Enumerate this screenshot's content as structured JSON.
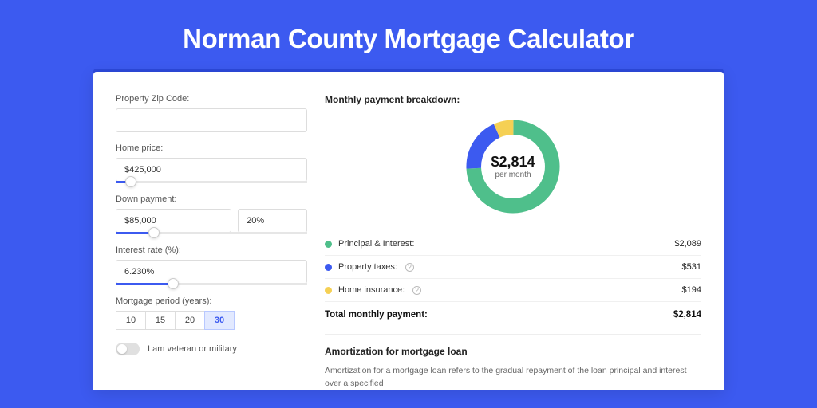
{
  "title": "Norman County Mortgage Calculator",
  "form": {
    "zip_label": "Property Zip Code:",
    "zip_value": "",
    "homeprice_label": "Home price:",
    "homeprice_value": "$425,000",
    "homeprice_slider_pct": 8,
    "downpayment_label": "Down payment:",
    "downpayment_value": "$85,000",
    "downpayment_pct": "20%",
    "downpayment_slider_pct": 20,
    "rate_label": "Interest rate (%):",
    "rate_value": "6.230%",
    "rate_slider_pct": 30,
    "period_label": "Mortgage period (years):",
    "periods": [
      "10",
      "15",
      "20",
      "30"
    ],
    "period_active": "30",
    "veteran_label": "I am veteran or military",
    "veteran_on": false
  },
  "breakdown": {
    "title": "Monthly payment breakdown:",
    "donut": {
      "amount": "$2,814",
      "sub": "per month"
    },
    "items": [
      {
        "label": "Principal & Interest:",
        "value": "$2,089",
        "color": "#4fbf8b",
        "info": false
      },
      {
        "label": "Property taxes:",
        "value": "$531",
        "color": "#3c5af0",
        "info": true
      },
      {
        "label": "Home insurance:",
        "value": "$194",
        "color": "#f5d054",
        "info": true
      }
    ],
    "total_label": "Total monthly payment:",
    "total_value": "$2,814"
  },
  "amort": {
    "title": "Amortization for mortgage loan",
    "text": "Amortization for a mortgage loan refers to the gradual repayment of the loan principal and interest over a specified"
  },
  "chart_data": {
    "type": "pie",
    "title": "Monthly payment breakdown",
    "series": [
      {
        "name": "Principal & Interest",
        "value": 2089,
        "color": "#4fbf8b"
      },
      {
        "name": "Property taxes",
        "value": 531,
        "color": "#3c5af0"
      },
      {
        "name": "Home insurance",
        "value": 194,
        "color": "#f5d054"
      }
    ],
    "total": 2814,
    "center_label": "$2,814 per month"
  }
}
